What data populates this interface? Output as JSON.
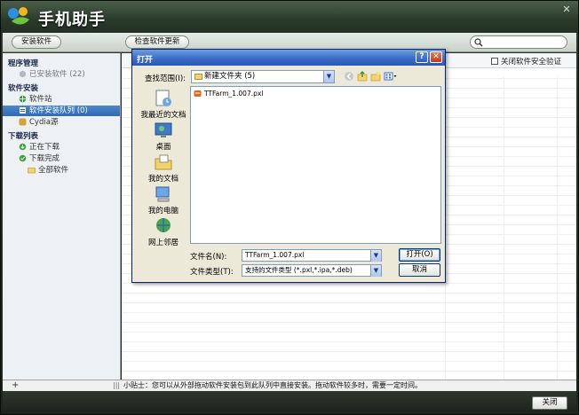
{
  "app": {
    "title": "手机助手",
    "close_glyph": "✕"
  },
  "toolbar": {
    "install_label": "安装软件",
    "check_update_label": "检查软件更新",
    "search_placeholder": ""
  },
  "sidebar": {
    "groups": [
      {
        "label": "程序管理",
        "items": [
          {
            "label": "已安装软件 (22)",
            "icon": "phone-icon",
            "selected": false
          }
        ]
      },
      {
        "label": "软件安装",
        "items": [
          {
            "label": "软件站",
            "icon": "globe-icon",
            "selected": false
          },
          {
            "label": "软件安装队列 (0)",
            "icon": "queue-icon",
            "selected": true
          },
          {
            "label": "Cydia源",
            "icon": "cydia-icon",
            "selected": false
          }
        ]
      },
      {
        "label": "下载列表",
        "items": [
          {
            "label": "正在下载",
            "icon": "download-icon",
            "selected": false
          },
          {
            "label": "下载完成",
            "icon": "download-done-icon",
            "selected": false
          },
          {
            "label": "全部软件",
            "icon": "folder-icon",
            "selected": false
          }
        ]
      }
    ]
  },
  "main": {
    "verify_label": "关闭软件安全验证"
  },
  "statusbar": {
    "plus": "+",
    "grip": "|||",
    "tip": "小贴士：您可以从外部拖动软件安装包到此队列中直接安装。拖动软件较多时，需要一定时间。"
  },
  "footer": {
    "close_label": "关闭"
  },
  "dialog": {
    "title": "打开",
    "help_glyph": "?",
    "close_glyph": "✕",
    "look_in_label": "查找范围(I):",
    "look_in_value": "新建文件夹 (5)",
    "places": [
      "我最近的文档",
      "桌面",
      "我的文档",
      "我的电脑",
      "网上邻居"
    ],
    "files": [
      "TTFarm_1.007.pxl"
    ],
    "filename_label": "文件名(N):",
    "filename_value": "TTFarm_1.007.pxl",
    "filetype_label": "文件类型(T):",
    "filetype_value": "支持的文件类型 (*.pxl,*.ipa,*.deb)",
    "open_label": "打开(O)",
    "cancel_label": "取消"
  },
  "colors": {
    "title_bar": "#2a3a2a",
    "sidebar_selected": "#2f6bb3",
    "dialog_title": "#3b6cc7"
  }
}
